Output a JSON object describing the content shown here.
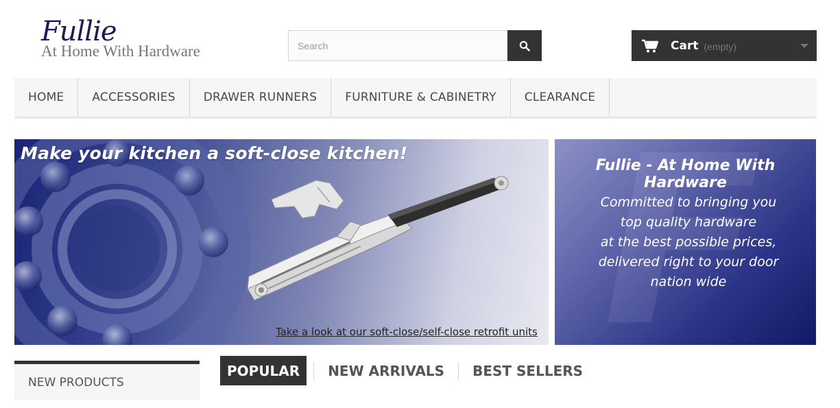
{
  "brand": {
    "name": "Fullie",
    "tagline": "At Home With Hardware"
  },
  "search": {
    "placeholder": "Search",
    "button_icon": "search-icon"
  },
  "cart": {
    "label": "Cart",
    "status": "(empty)",
    "icon": "shopping-cart-icon"
  },
  "menu": {
    "items": [
      {
        "label": "HOME"
      },
      {
        "label": "ACCESSORIES"
      },
      {
        "label": "DRAWER RUNNERS"
      },
      {
        "label": "FURNITURE & CABINETRY"
      },
      {
        "label": "CLEARANCE"
      }
    ]
  },
  "banner_left": {
    "headline": "Make your kitchen a soft-close kitchen!",
    "link": "Take a look at our soft-close/self-close retrofit units"
  },
  "banner_right": {
    "title": "Fullie - At Home With Hardware",
    "lines": [
      "Committed to bringing you",
      "top quality hardware",
      "at the best possible prices,",
      "delivered right to your door",
      "nation wide"
    ]
  },
  "sidebar": {
    "new_products": "NEW PRODUCTS"
  },
  "tabs": [
    {
      "label": "POPULAR",
      "active": true
    },
    {
      "label": "NEW ARRIVALS",
      "active": false
    },
    {
      "label": "BEST SELLERS",
      "active": false
    }
  ],
  "colors": {
    "brand_navy": "#1c1c54",
    "dark_button": "#333333",
    "menu_bg": "#f6f6f6"
  }
}
